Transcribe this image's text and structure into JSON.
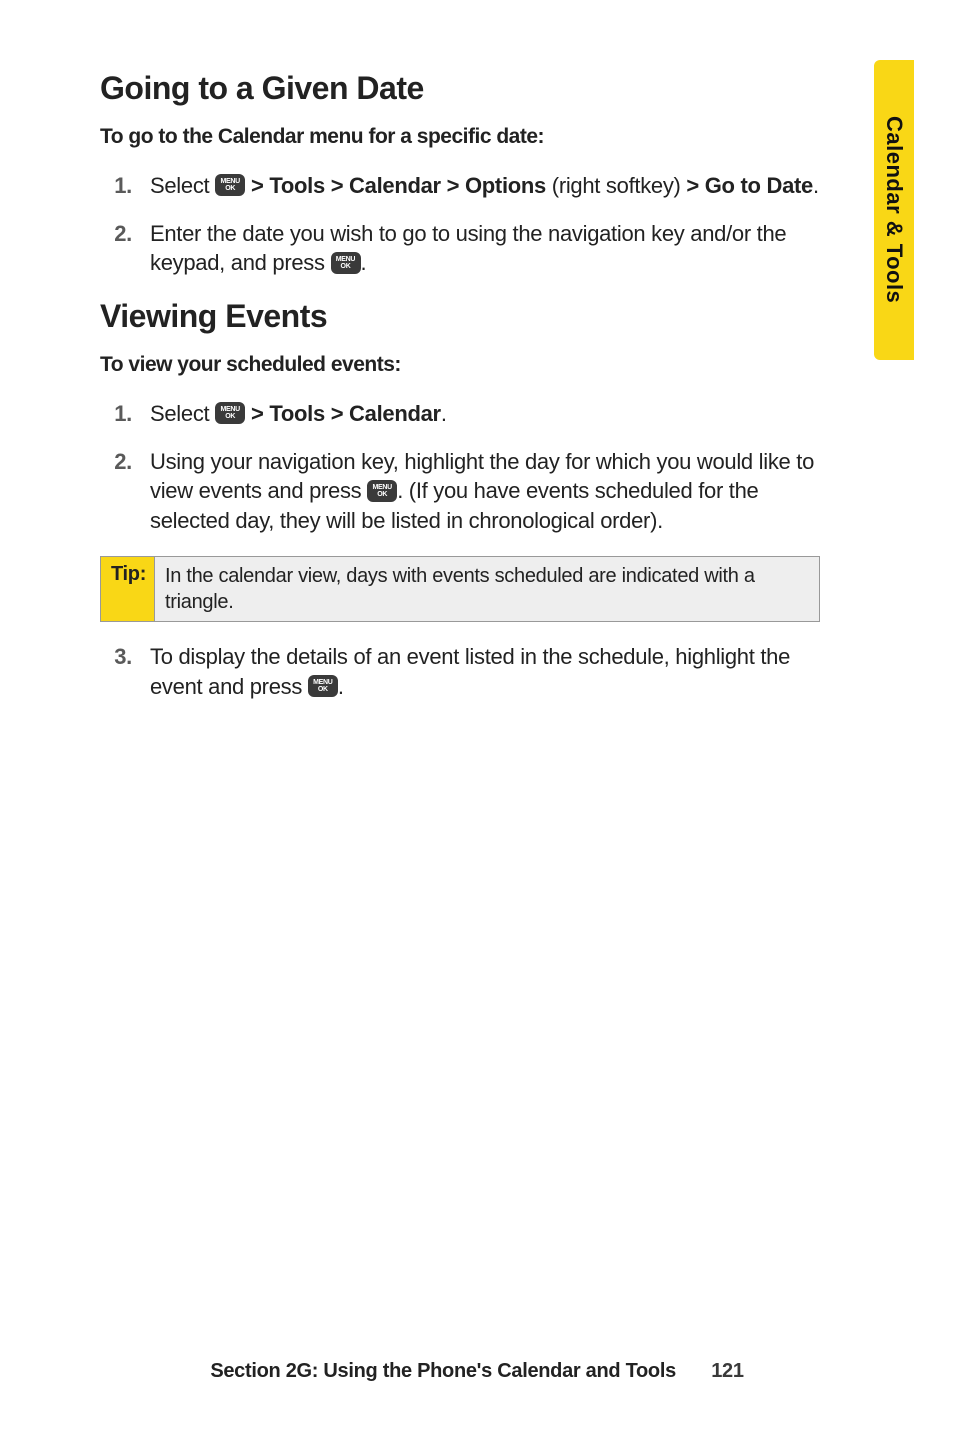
{
  "sideTab": "Calendar & Tools",
  "menuIcon": {
    "line1": "MENU",
    "line2": "OK"
  },
  "section1": {
    "heading": "Going to a Given Date",
    "subheading": "To go to the Calendar menu for a specific date:",
    "step1": {
      "select": "Select ",
      "arrow1": " > ",
      "tools": "Tools > Calendar > Options",
      "rightSoftkey": " (right softkey) ",
      "arrow2": "> ",
      "goToDate": "Go to Date",
      "period": "."
    },
    "step2": {
      "pre": "Enter the date you wish to go to using the navigation key and/or the keypad, and press ",
      "post": "."
    }
  },
  "section2": {
    "heading": "Viewing Events",
    "subheading": "To view your scheduled events:",
    "step1": {
      "select": "Select ",
      "arrow": " > ",
      "toolsCalendar": "Tools > Calendar",
      "period": "."
    },
    "step2": {
      "pre": "Using your navigation key, highlight the day for which you would like to view events and press ",
      "post": ". (If you have events scheduled for the selected day, they will be listed in chronological order)."
    },
    "tipLabel": "Tip:",
    "tipBody": "In the calendar view, days with events scheduled are indicated with a triangle.",
    "step3": {
      "pre": "To display the details of an event listed in the schedule, highlight the event and press ",
      "post": "."
    }
  },
  "footer": {
    "text": "Section 2G: Using the Phone's Calendar and Tools",
    "page": "121"
  }
}
